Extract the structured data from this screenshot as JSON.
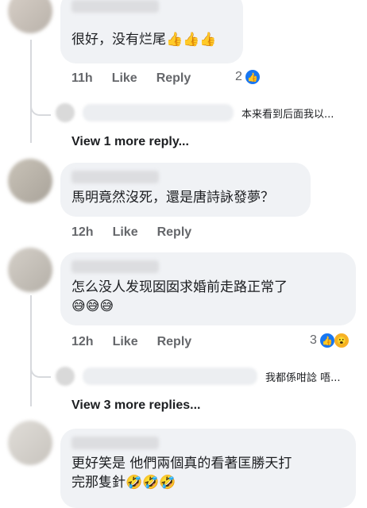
{
  "comments": [
    {
      "text": "很好，没有烂尾",
      "emoji": "👍👍👍",
      "time": "11h",
      "like_label": "Like",
      "reply_label": "Reply",
      "reaction_count": "2",
      "replies_preview": "本来看到后面我以...",
      "view_more": "View 1 more reply..."
    },
    {
      "text": "馬明竟然沒死，還是唐詩詠發夢？",
      "time": "12h",
      "like_label": "Like",
      "reply_label": "Reply"
    },
    {
      "text": "怎么没人发现囡囡求婚前走路正常了",
      "emoji": "😅😅😅",
      "time": "12h",
      "like_label": "Like",
      "reply_label": "Reply",
      "reaction_count": "3",
      "replies_preview": "我都係咁諗 唔...",
      "view_more": "View 3 more replies..."
    },
    {
      "text_line1": "更好笑是 他們兩個真的看著匡勝天打",
      "text_line2": "完那隻針",
      "emoji": "🤣🤣🤣"
    }
  ],
  "icons": {
    "like": "like-icon",
    "wow": "wow-icon"
  },
  "colors": {
    "bubble_bg": "#f0f2f5",
    "meta_text": "#65676b",
    "like_blue": "#1877f2"
  }
}
